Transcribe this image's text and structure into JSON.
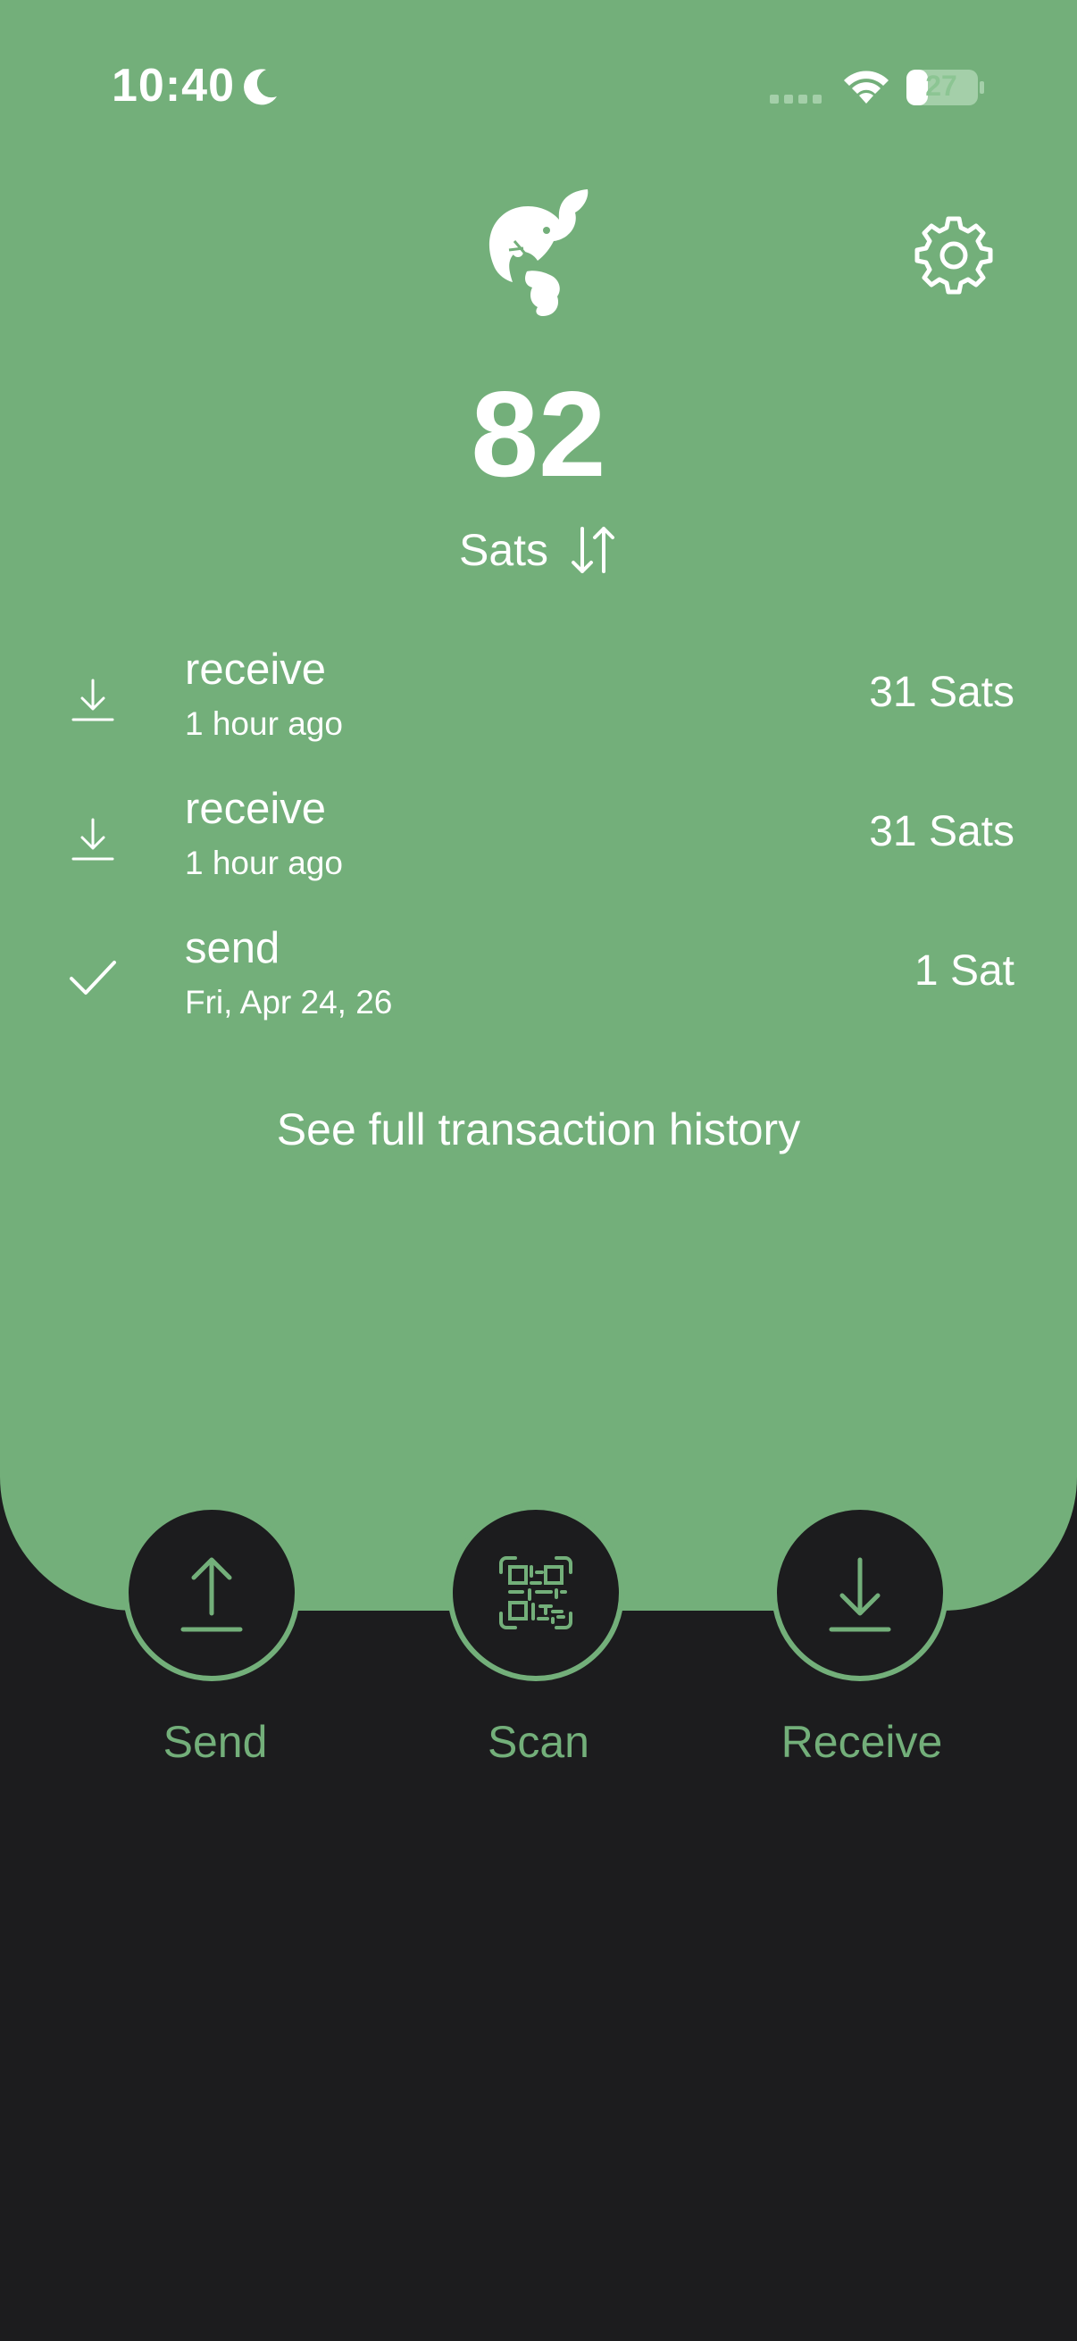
{
  "status_bar": {
    "time": "10:40",
    "battery": "27",
    "icons": [
      "moon-icon",
      "cellular-signal-icon",
      "wifi-icon",
      "battery-icon"
    ]
  },
  "header": {
    "logo_icon": "squirrel-logo-icon",
    "settings_icon": "gear-icon"
  },
  "balance": {
    "amount": "82",
    "unit": "Sats",
    "toggle_icon": "swap-arrows-icon"
  },
  "transactions": [
    {
      "type": "receive",
      "time": "1 hour ago",
      "amount": "31 Sats",
      "icon": "download-icon"
    },
    {
      "type": "receive",
      "time": "1 hour ago",
      "amount": "31 Sats",
      "icon": "download-icon"
    },
    {
      "type": "send",
      "time": "Fri, Apr 24, 26",
      "amount": "1 Sat",
      "icon": "checkmark-icon"
    }
  ],
  "history_link": "See full transaction history",
  "actions": {
    "send": "Send",
    "scan": "Scan",
    "receive": "Receive"
  },
  "colors": {
    "accent": "#73af7a",
    "background": "#1c1c1e",
    "text": "#ffffff"
  }
}
